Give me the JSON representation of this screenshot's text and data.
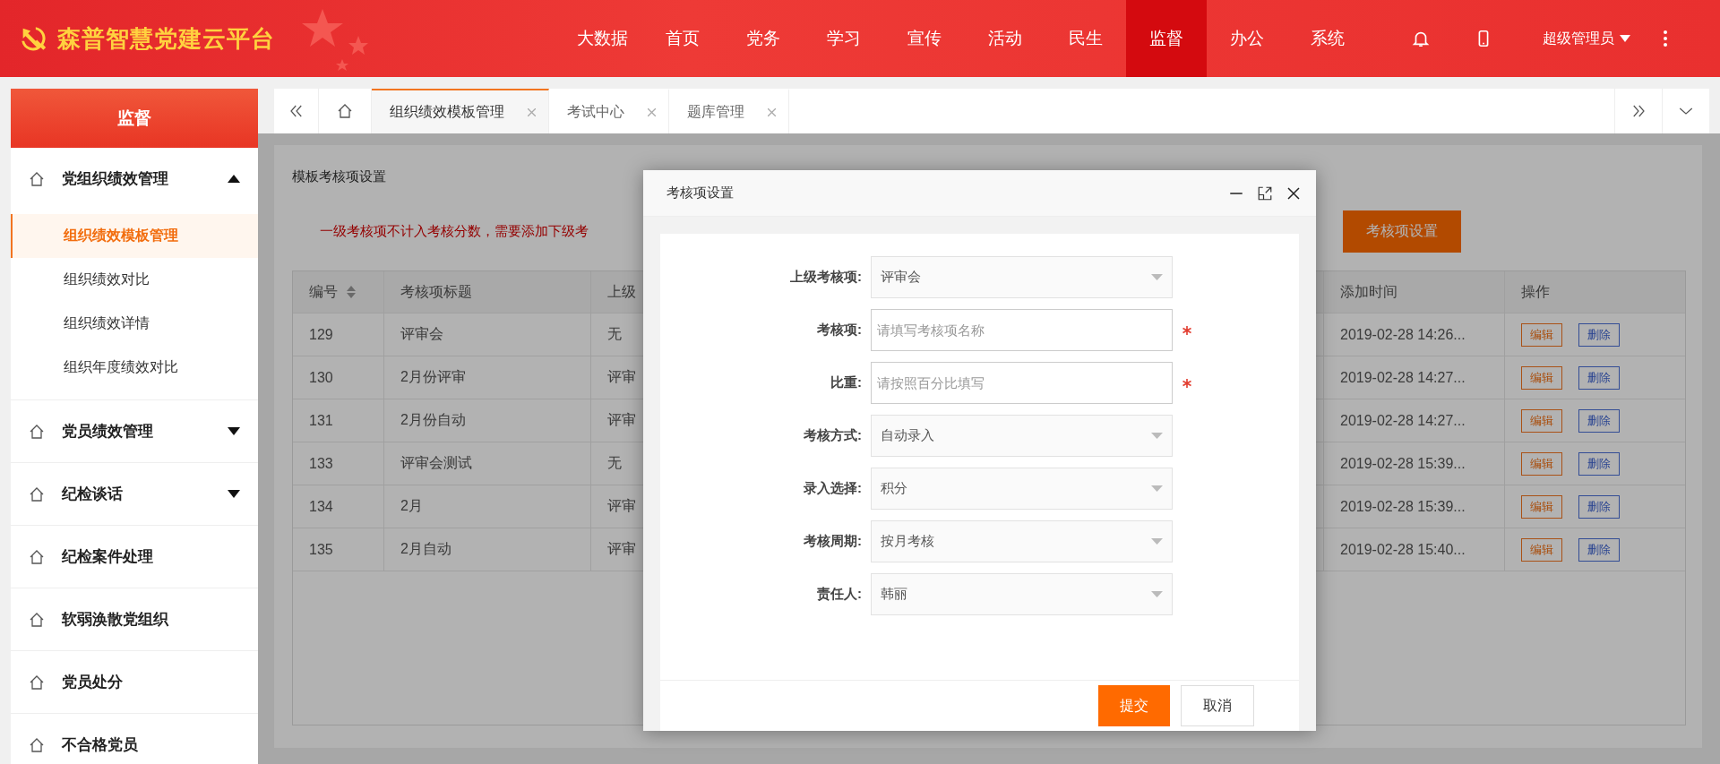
{
  "header": {
    "title": "森普智慧党建云平台",
    "nav": [
      {
        "label": "大数据",
        "selected": false
      },
      {
        "label": "首页",
        "selected": false
      },
      {
        "label": "党务",
        "selected": false
      },
      {
        "label": "学习",
        "selected": false
      },
      {
        "label": "宣传",
        "selected": false
      },
      {
        "label": "活动",
        "selected": false
      },
      {
        "label": "民生",
        "selected": false
      },
      {
        "label": "监督",
        "selected": true
      },
      {
        "label": "办公",
        "selected": false
      },
      {
        "label": "系统",
        "selected": false
      }
    ],
    "user": "超级管理员"
  },
  "sidebar": {
    "title": "监督",
    "items": [
      {
        "label": "党组织绩效管理",
        "kind": "menu",
        "expanded": true,
        "children": [
          {
            "label": "组织绩效模板管理",
            "selected": true
          },
          {
            "label": "组织绩效对比",
            "selected": false
          },
          {
            "label": "组织绩效详情",
            "selected": false
          },
          {
            "label": "组织年度绩效对比",
            "selected": false
          }
        ]
      },
      {
        "label": "党员绩效管理",
        "kind": "menu",
        "expanded": false
      },
      {
        "label": "纪检谈话",
        "kind": "menu",
        "expanded": false
      },
      {
        "label": "纪检案件处理",
        "kind": "link"
      },
      {
        "label": "软弱涣散党组织",
        "kind": "link"
      },
      {
        "label": "党员处分",
        "kind": "link"
      },
      {
        "label": "不合格党员",
        "kind": "link"
      }
    ]
  },
  "tabs": [
    {
      "label": "组织绩效模板管理",
      "selected": true
    },
    {
      "label": "考试中心",
      "selected": false
    },
    {
      "label": "题库管理",
      "selected": false
    }
  ],
  "panel": {
    "heading": "模板考核项设置",
    "notice": "一级考核项不计入考核分数，需要添加下级考",
    "button": "考核项设置",
    "table": {
      "columns": [
        {
          "label": "编号",
          "sortable": true
        },
        {
          "label": "考核项标题",
          "sortable": false
        },
        {
          "label": "上级"
        },
        {
          "label": "添加时间",
          "sortable": false
        },
        {
          "label": "操作",
          "sortable": false
        }
      ],
      "rows": [
        {
          "cells": [
            "129",
            "评审会",
            "无",
            "2019-02-28 14:26..."
          ],
          "actions": [
            {
              "label": "编辑",
              "kind": "edit"
            },
            {
              "label": "删除",
              "kind": "delete"
            }
          ]
        },
        {
          "cells": [
            "130",
            "2月份评审",
            "评审",
            "2019-02-28 14:27..."
          ],
          "actions": [
            {
              "label": "编辑",
              "kind": "edit"
            },
            {
              "label": "删除",
              "kind": "delete"
            }
          ]
        },
        {
          "cells": [
            "131",
            "2月份自动",
            "评审",
            "2019-02-28 14:27..."
          ],
          "actions": [
            {
              "label": "编辑",
              "kind": "edit"
            },
            {
              "label": "删除",
              "kind": "delete"
            }
          ]
        },
        {
          "cells": [
            "133",
            "评审会测试",
            "无",
            "2019-02-28 15:39..."
          ],
          "actions": [
            {
              "label": "编辑",
              "kind": "edit"
            },
            {
              "label": "删除",
              "kind": "delete"
            }
          ]
        },
        {
          "cells": [
            "134",
            "2月",
            "评审",
            "2019-02-28 15:39..."
          ],
          "actions": [
            {
              "label": "编辑",
              "kind": "edit"
            },
            {
              "label": "删除",
              "kind": "delete"
            }
          ]
        },
        {
          "cells": [
            "135",
            "2月自动",
            "评审",
            "2019-02-28 15:40..."
          ],
          "actions": [
            {
              "label": "编辑",
              "kind": "edit"
            },
            {
              "label": "删除",
              "kind": "delete"
            }
          ]
        }
      ]
    }
  },
  "dialog": {
    "title": "考核项设置",
    "fields": [
      {
        "label": "上级考核项:",
        "kind": "select",
        "value": "评审会",
        "required": false
      },
      {
        "label": "考核项:",
        "kind": "input",
        "placeholder": "请填写考核项名称",
        "required": true
      },
      {
        "label": "比重:",
        "kind": "input",
        "placeholder": "请按照百分比填写",
        "required": true
      },
      {
        "label": "考核方式:",
        "kind": "select",
        "value": "自动录入",
        "required": false
      },
      {
        "label": "录入选择:",
        "kind": "select",
        "value": "积分",
        "required": false
      },
      {
        "label": "考核周期:",
        "kind": "select",
        "value": "按月考核",
        "required": false
      },
      {
        "label": "责任人:",
        "kind": "select",
        "value": "韩丽",
        "required": false
      }
    ],
    "buttons": [
      {
        "label": "提交",
        "kind": "primary"
      },
      {
        "label": "取消",
        "kind": "secondary"
      }
    ]
  }
}
